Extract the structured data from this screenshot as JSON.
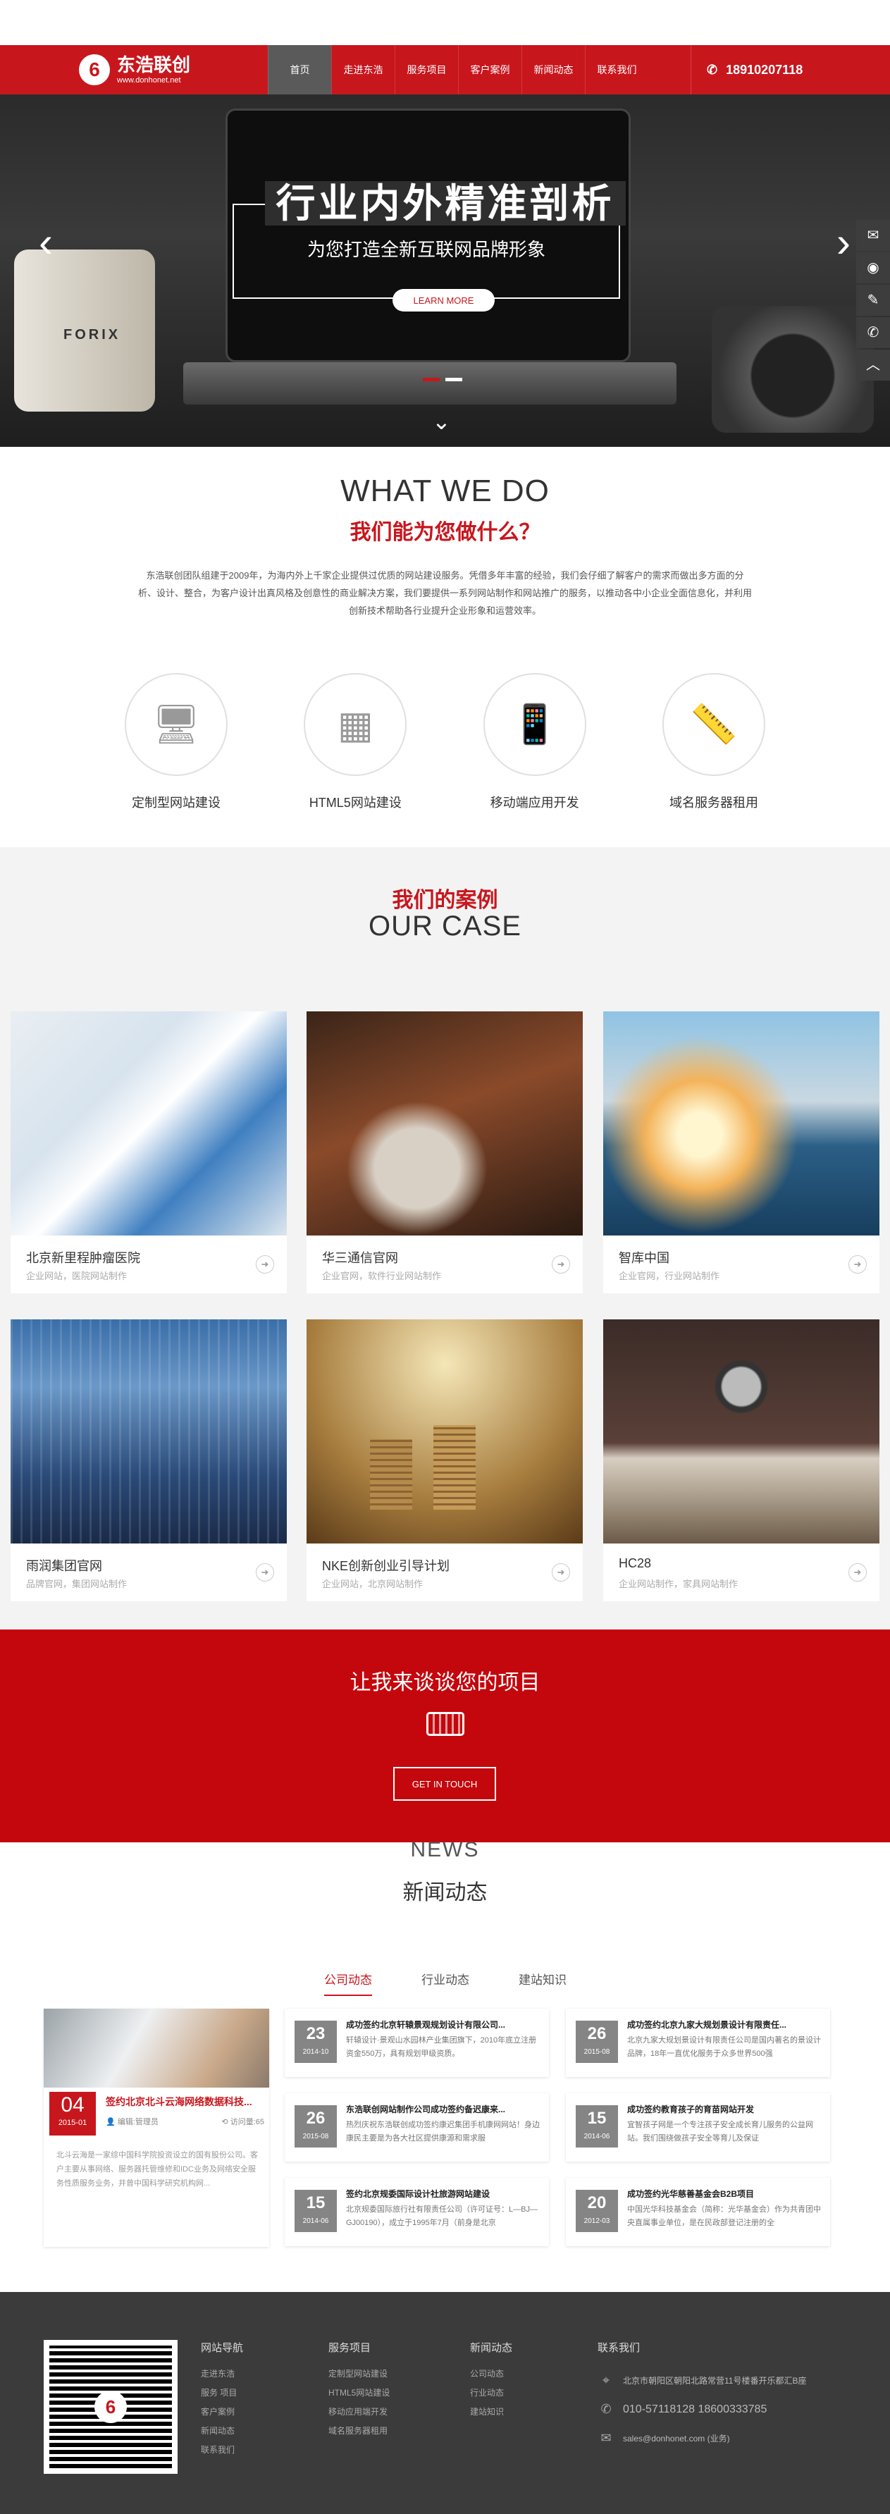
{
  "header": {
    "logo_name": "东浩联创",
    "logo_url": "www.donhonet.net",
    "nav": [
      "首页",
      "走进东浩",
      "服务项目",
      "客户案例",
      "新闻动态",
      "联系我们"
    ],
    "phone": "18910207118"
  },
  "banner": {
    "title": "行业内外精准剖析",
    "subtitle": "为您打造全新互联网品牌形象",
    "button": "LEARN MORE",
    "mug_text": "FORIX"
  },
  "whatwedo": {
    "en": "WHAT WE DO",
    "cn": "我们能为您做什么？",
    "intro": "东浩联创团队组建于2009年，为海内外上千家企业提供过优质的网站建设服务。凭借多年丰富的经验，我们会仔细了解客户的需求而做出多方面的分析、设计、整合，为客户设计出真风格及创意性的商业解决方案，我们要提供一系列网站制作和网站推广的服务，以推动各中小企业全面信息化，并利用创新技术帮助各行业提升企业形象和运营效率。",
    "services": [
      "定制型网站建设",
      "HTML5网站建设",
      "移动端应用开发",
      "域名服务器租用"
    ]
  },
  "cases": {
    "cn": "我们的案例",
    "en": "OUR CASE",
    "items": [
      {
        "title": "北京新里程肿瘤医院",
        "desc": "企业网站，医院网站制作"
      },
      {
        "title": "华三通信官网",
        "desc": "企业官网，软件行业网站制作"
      },
      {
        "title": "智库中国",
        "desc": "企业官网，行业网站制作"
      },
      {
        "title": "雨润集团官网",
        "desc": "品牌官网，集团网站制作"
      },
      {
        "title": "NKE创新创业引导计划",
        "desc": "企业网站，北京网站制作"
      },
      {
        "title": "HC28",
        "desc": "企业网站制作，家具网站制作"
      }
    ]
  },
  "talk": {
    "heading": "让我来谈谈您的项目",
    "button": "GET IN TOUCH"
  },
  "news": {
    "en": "NEWS",
    "cn": "新闻动态",
    "tabs": [
      "公司动态",
      "行业动态",
      "建站知识"
    ],
    "featured": {
      "day": "04",
      "month": "2015-01",
      "title": "签约北京北斗云海网络数据科技...",
      "author": "编辑:管理员",
      "views": "访问量:65",
      "excerpt": "北斗云海是一家综中国科学院投资设立的国有股份公司。客户主要从事网络、服务器托管维修和IDC业务及网络安全服务性质服务业务，并曾中国科学研究机构网..."
    },
    "items": [
      {
        "day": "23",
        "month": "2014-10",
        "title": "成功签约北京轩辕景观规划设计有限公司...",
        "summary": "轩辕设计·景观山水园林产业集团旗下，2010年底立注册资金550万，具有规划甲级资质。"
      },
      {
        "day": "26",
        "month": "2015-08",
        "title": "成功签约北京九家大规划景设计有限责任...",
        "summary": "北京九家大规划景设计有限责任公司是国内著名的景设计品牌，18年一直优化服务于众多世界500强"
      },
      {
        "day": "26",
        "month": "2015-08",
        "title": "东浩联创网站制作公司成功签约备迟康来...",
        "summary": "热烈庆祝东浩联创成功签约康迟集团手机康网网站！身边康民主要是为各大社区提供康源和需求服"
      },
      {
        "day": "15",
        "month": "2014-06",
        "title": "成功签约教育孩子的育苗网站开发",
        "summary": "宜智孩子网是一个专注孩子安全成长育儿服务的公益网站。我们围绕做孩子安全等育儿及保证"
      },
      {
        "day": "15",
        "month": "2014-06",
        "title": "签约北京规委国际设计社旅游网站建设",
        "summary": "北京规委国际旅行社有限责任公司（许可证号：L—BJ—GJ00190），成立于1995年7月（前身是北京"
      },
      {
        "day": "20",
        "month": "2012-03",
        "title": "成功签约光华慈善基金会B2B项目",
        "summary": "中国光华科技基金会（简称：光华基金会）作为共青团中央直属事业单位，是在民政部登记注册的全"
      }
    ]
  },
  "footer": {
    "cols": [
      {
        "title": "网站导航",
        "links": [
          "走进东浩",
          "服务 项目",
          "客户案例",
          "新闻动态",
          "联系我们"
        ]
      },
      {
        "title": "服务项目",
        "links": [
          "定制型网站建设",
          "HTML5网站建设",
          "移动应用端开发",
          "域名服务器租用"
        ]
      },
      {
        "title": "新闻动态",
        "links": [
          "公司动态",
          "行业动态",
          "建站知识"
        ]
      }
    ],
    "contact_title": "联系我们",
    "address": "北京市朝阳区朝阳北路常营11号楼番开乐都汇B座",
    "phones": "010-57118128  18600333785",
    "email": "sales@donhonet.com (业务)",
    "qr_logo": "6"
  },
  "colors": {
    "brand": "#c8161d",
    "nav_active": "#5a5a5a",
    "footer": "#3b3b3b"
  }
}
